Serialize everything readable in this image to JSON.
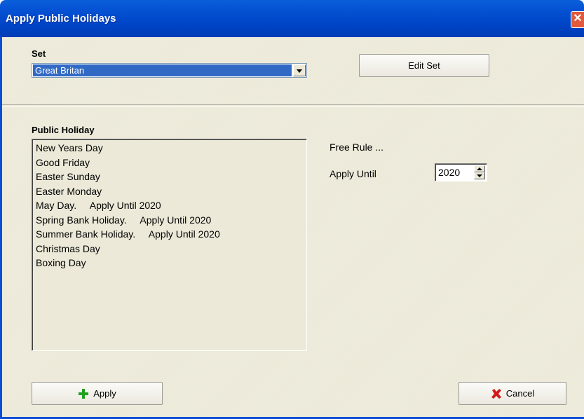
{
  "window": {
    "title": "Apply Public Holidays",
    "close_glyph": "✕"
  },
  "set": {
    "label": "Set",
    "selected": "Great Britan",
    "edit_button": "Edit Set"
  },
  "public_holiday": {
    "label": "Public Holiday",
    "items": [
      "New Years Day",
      "Good Friday",
      "Easter Sunday",
      "Easter Monday",
      "May Day.     Apply Until 2020",
      "Spring Bank Holiday.     Apply Until 2020",
      "Summer Bank Holiday.     Apply Until 2020",
      "Christmas Day",
      "Boxing Day"
    ]
  },
  "rule": {
    "free_rule": "Free Rule ...",
    "apply_until_label": "Apply Until",
    "apply_until_value": "2020"
  },
  "buttons": {
    "apply": "Apply",
    "cancel": "Cancel"
  },
  "colors": {
    "titlebar": "#0046c8",
    "selection": "#316ac5",
    "dialog_bg": "#ece9d8",
    "apply_icon": "#1fa11f",
    "cancel_icon": "#d01a1a"
  },
  "icons": {
    "apply": "plus-icon",
    "cancel": "x-icon"
  }
}
